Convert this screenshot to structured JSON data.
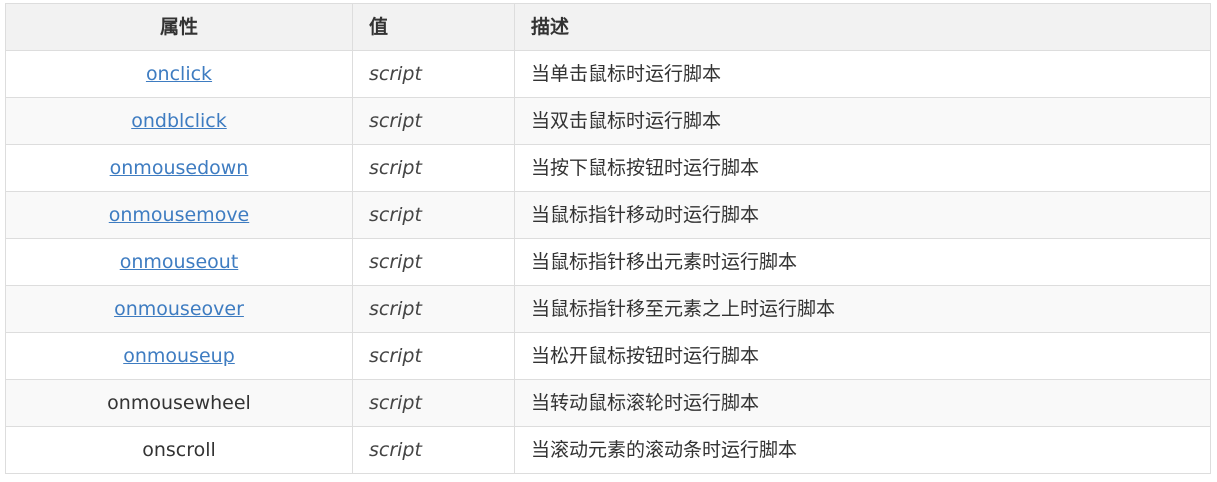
{
  "table": {
    "headers": {
      "attribute": "属性",
      "value": "值",
      "description": "描述"
    },
    "rows": [
      {
        "attribute": "onclick",
        "is_link": true,
        "value": "script",
        "description": "当单击鼠标时运行脚本"
      },
      {
        "attribute": "ondblclick",
        "is_link": true,
        "value": "script",
        "description": "当双击鼠标时运行脚本"
      },
      {
        "attribute": "onmousedown",
        "is_link": true,
        "value": "script",
        "description": "当按下鼠标按钮时运行脚本"
      },
      {
        "attribute": "onmousemove",
        "is_link": true,
        "value": "script",
        "description": "当鼠标指针移动时运行脚本"
      },
      {
        "attribute": "onmouseout",
        "is_link": true,
        "value": "script",
        "description": "当鼠标指针移出元素时运行脚本"
      },
      {
        "attribute": "onmouseover",
        "is_link": true,
        "value": "script",
        "description": "当鼠标指针移至元素之上时运行脚本"
      },
      {
        "attribute": "onmouseup",
        "is_link": true,
        "value": "script",
        "description": "当松开鼠标按钮时运行脚本"
      },
      {
        "attribute": "onmousewheel",
        "is_link": false,
        "value": "script",
        "description": "当转动鼠标滚轮时运行脚本"
      },
      {
        "attribute": "onscroll",
        "is_link": false,
        "value": "script",
        "description": "当滚动元素的滚动条时运行脚本"
      }
    ]
  },
  "colors": {
    "link": "#3e7cc1",
    "header_bg": "#f2f2f2",
    "stripe_bg": "#f9f9f9",
    "border": "#dddddd"
  }
}
